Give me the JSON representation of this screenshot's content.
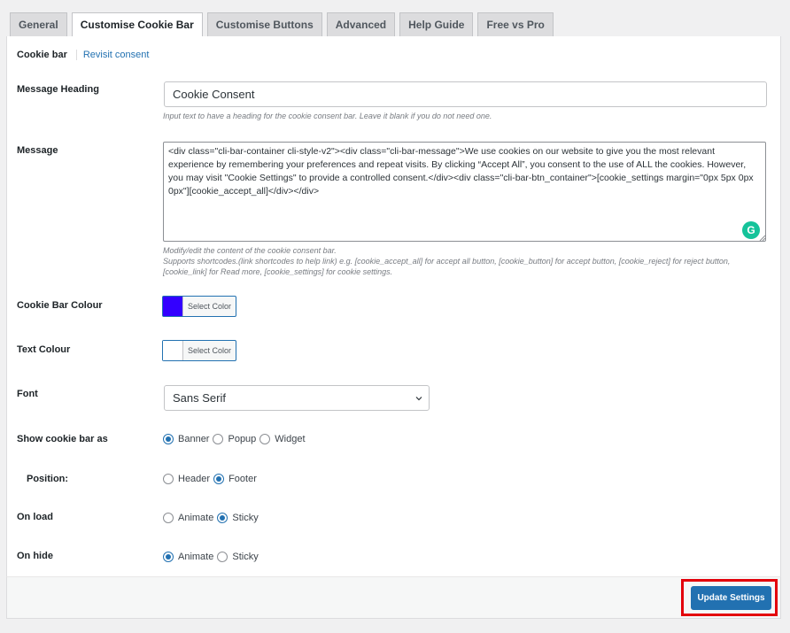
{
  "tabs": [
    "General",
    "Customise Cookie Bar",
    "Customise Buttons",
    "Advanced",
    "Help Guide",
    "Free vs Pro"
  ],
  "subnav": {
    "active": "Cookie bar",
    "link": "Revisit consent"
  },
  "message_heading": {
    "label": "Message Heading",
    "value": "Cookie Consent",
    "help": "Input text to have a heading for the cookie consent bar. Leave it blank if you do not need one."
  },
  "message": {
    "label": "Message",
    "value": "<div class=\"cli-bar-container cli-style-v2\"><div class=\"cli-bar-message\">We use cookies on our website to give you the most relevant experience by remembering your preferences and repeat visits. By clicking “Accept All”, you consent to the use of ALL the cookies. However, you may visit \"Cookie Settings\" to provide a controlled consent.</div><div class=\"cli-bar-btn_container\">[cookie_settings margin=\"0px 5px 0px 0px\"][cookie_accept_all]</div></div>",
    "help_line1": "Modify/edit the content of the cookie consent bar.",
    "help_line2": "Supports shortcodes.(link shortcodes to help link) e.g. [cookie_accept_all] for accept all button, [cookie_button] for accept button, [cookie_reject] for reject button, [cookie_link] for Read more, [cookie_settings] for cookie settings.",
    "grammarly_icon": "grammarly-icon"
  },
  "cookie_bar_colour": {
    "label": "Cookie Bar Colour",
    "button": "Select Color",
    "color": "#3300ff"
  },
  "text_colour": {
    "label": "Text Colour",
    "button": "Select Color",
    "color": "#ffffff"
  },
  "font": {
    "label": "Font",
    "selected": "Sans Serif"
  },
  "show_as": {
    "label": "Show cookie bar as",
    "options": [
      "Banner",
      "Popup",
      "Widget"
    ],
    "selected": "Banner"
  },
  "position": {
    "label": "Position:",
    "options": [
      "Header",
      "Footer"
    ],
    "selected": "Footer"
  },
  "on_load": {
    "label": "On load",
    "options": [
      "Animate",
      "Sticky"
    ],
    "selected": "Sticky"
  },
  "on_hide": {
    "label": "On hide",
    "options": [
      "Animate",
      "Sticky"
    ],
    "selected": "Animate"
  },
  "update_button": "Update Settings",
  "colors": {
    "accent": "#2271b1",
    "highlight": "#e3000b"
  }
}
